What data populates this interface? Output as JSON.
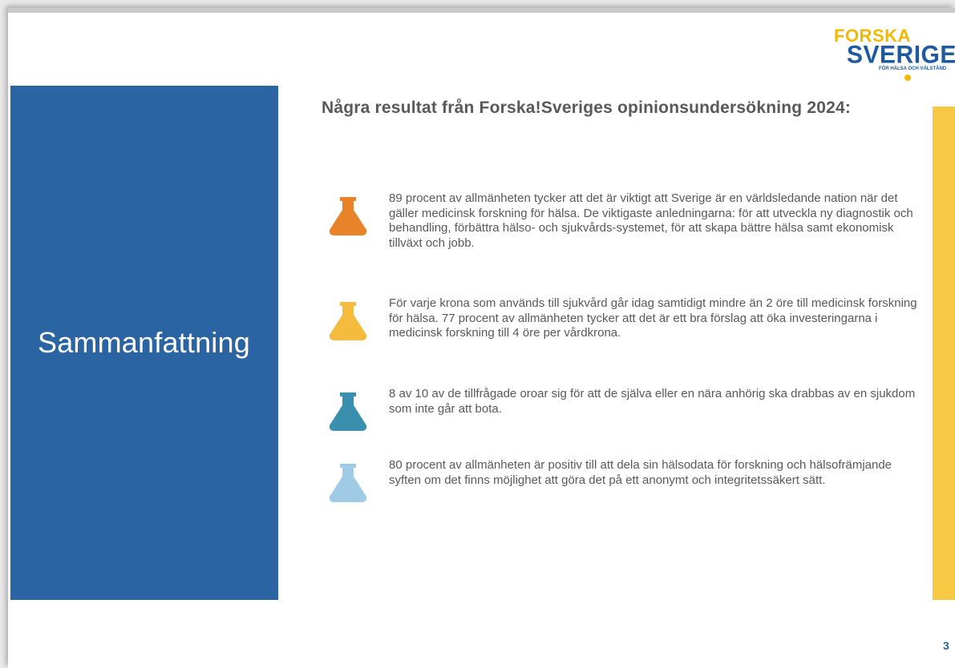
{
  "slide": {
    "title": "Sammanfattning",
    "heading": "Några resultat från Forska!Sveriges opinionsundersökning 2024:",
    "page_number": "3"
  },
  "logo": {
    "line1": "FORSKA",
    "line2": "SVERIGE",
    "tagline": "FÖR HÄLSA OCH VÄLSTÅND"
  },
  "items": [
    {
      "icon": "flask-icon",
      "color": "#e8832a",
      "text": "89 procent av allmänheten tycker att det är viktigt att Sverige är en världsledande nation när det gäller medicinsk forskning för hälsa. De viktigaste anledningarna: för att utveckla ny diagnostik och behandling, förbättra hälso- och sjukvårds-systemet, för att skapa bättre hälsa samt ekonomisk tillväxt och jobb."
    },
    {
      "icon": "flask-icon",
      "color": "#f5bb3c",
      "text": "För varje krona som används till sjukvård går idag samtidigt mindre än 2 öre till medicinsk forskning för hälsa. 77 procent av allmänheten tycker att det är ett bra förslag att öka investeringarna i medicinsk forskning till 4 öre per vårdkrona."
    },
    {
      "icon": "flask-icon",
      "color": "#3a8fae",
      "text": "8 av 10 av de tillfrågade oroar sig för att de själva eller en nära anhörig ska drabbas av en sjukdom som inte går att bota."
    },
    {
      "icon": "flask-icon",
      "color": "#9fcbe6",
      "text": "80 procent av allmänheten är positiv till att dela sin hälsodata för forskning och hälsofrämjande syften om det finns möjlighet att göra det på ett anonymt och integritetssäkert sätt."
    }
  ],
  "colors": {
    "panel_blue": "#2a64a3",
    "accent_yellow": "#f7c843",
    "text_gray": "#595959"
  }
}
